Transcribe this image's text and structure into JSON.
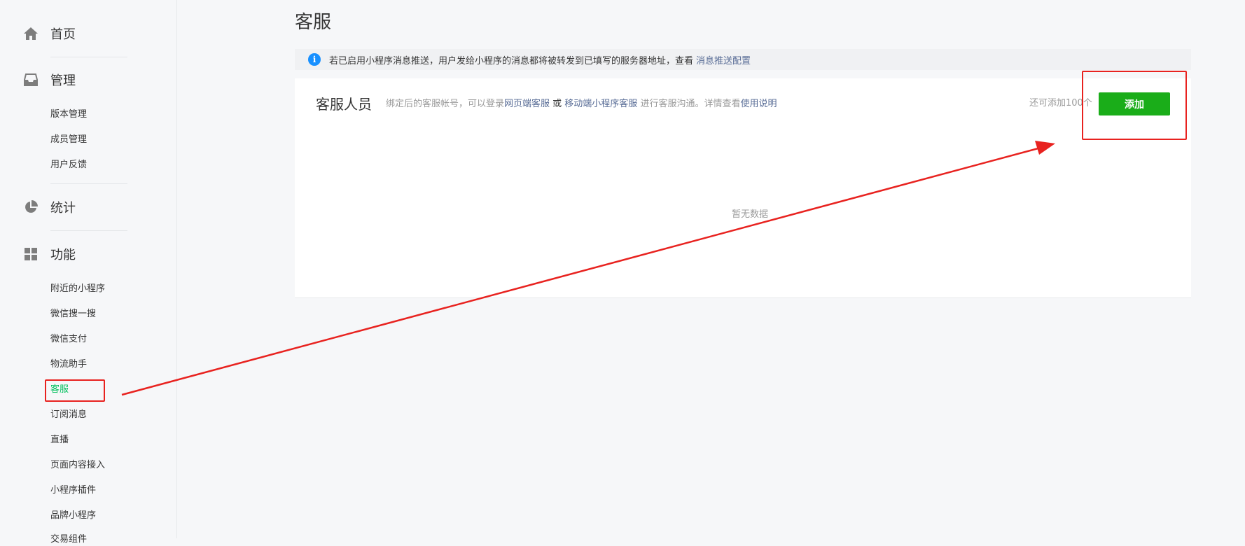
{
  "sidebar": {
    "groups": [
      {
        "label": "首页",
        "icon": "home-icon"
      },
      {
        "label": "管理",
        "icon": "inbox-icon"
      },
      {
        "label": "统计",
        "icon": "pie-chart-icon"
      },
      {
        "label": "功能",
        "icon": "grid-icon"
      }
    ],
    "manage_items": [
      "版本管理",
      "成员管理",
      "用户反馈"
    ],
    "feature_items": [
      "附近的小程序",
      "微信搜一搜",
      "微信支付",
      "物流助手",
      "客服",
      "订阅消息",
      "直播",
      "页面内容接入",
      "小程序插件",
      "品牌小程序",
      "交易组件"
    ],
    "active_item": "客服"
  },
  "page": {
    "title": "客服"
  },
  "notice": {
    "text": "若已启用小程序消息推送，用户发给小程序的消息都将被转发到已填写的服务器地址，查看",
    "link": "消息推送配置"
  },
  "card": {
    "title": "客服人员",
    "desc_prefix": "绑定后的客服帐号，可以登录",
    "desc_link_web": "网页端客服",
    "desc_or": " 或 ",
    "desc_link_mobile": "移动端小程序客服",
    "desc_middle": " 进行客服沟通。详情查看",
    "desc_link_help": "使用说明",
    "remaining": "还可添加100个",
    "add_button": "添加",
    "empty_text": "暂无数据"
  },
  "colors": {
    "accent_green": "#1aad19",
    "link_blue": "#576b95",
    "annotation_red": "#e8221f",
    "info_blue": "#1890ff"
  }
}
